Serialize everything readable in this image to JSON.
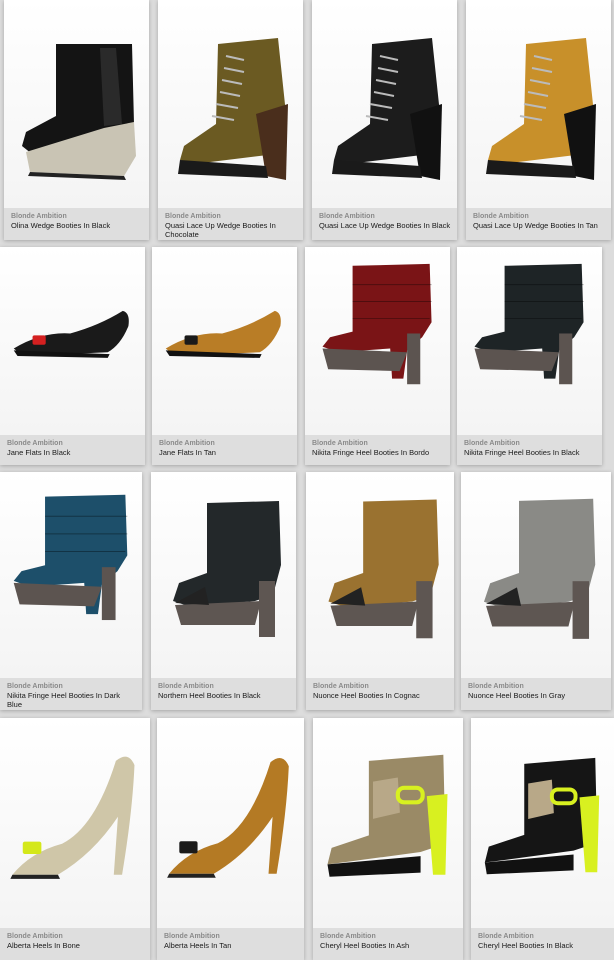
{
  "colors": {
    "page_bg": "#dcdcdc",
    "caption_bg": "#dedede",
    "brand_text": "#8a8a8a",
    "name_text": "#1a1a1a"
  },
  "products": [
    {
      "brand": "Blonde Ambition",
      "name": "Olina Wedge Booties In Black",
      "shoe": "wedge-bootie",
      "upper": "#141414",
      "accent": "#c9c4b4"
    },
    {
      "brand": "Blonde Ambition",
      "name": "Quasi Lace Up Wedge Booties In Chocolate",
      "shoe": "lace-wedge",
      "upper": "#6b5a22",
      "accent": "#4a2e1c"
    },
    {
      "brand": "Blonde Ambition",
      "name": "Quasi Lace Up Wedge Booties In Black",
      "shoe": "lace-wedge",
      "upper": "#1c1c1c",
      "accent": "#111111"
    },
    {
      "brand": "Blonde Ambition",
      "name": "Quasi Lace Up Wedge Booties In Tan",
      "shoe": "lace-wedge",
      "upper": "#c8902a",
      "accent": "#111111"
    },
    {
      "brand": "Blonde Ambition",
      "name": "Jane Flats In Black",
      "shoe": "flat",
      "upper": "#1a1a1a",
      "accent": "#d42020"
    },
    {
      "brand": "Blonde Ambition",
      "name": "Jane Flats In Tan",
      "shoe": "flat",
      "upper": "#b97d26",
      "accent": "#1a1a1a"
    },
    {
      "brand": "Blonde Ambition",
      "name": "Nikita Fringe Heel Booties In Bordo",
      "shoe": "fringe-heel",
      "upper": "#7a1416",
      "accent": "#5c5450"
    },
    {
      "brand": "Blonde Ambition",
      "name": "Nikita Fringe Heel Booties In Black",
      "shoe": "fringe-heel",
      "upper": "#1e2426",
      "accent": "#5c5450"
    },
    {
      "brand": "Blonde Ambition",
      "name": "Nikita Fringe Heel Booties In Dark Blue",
      "shoe": "fringe-heel",
      "upper": "#1d4f6a",
      "accent": "#5c5450"
    },
    {
      "brand": "Blonde Ambition",
      "name": "Northern Heel Booties In Black",
      "shoe": "heel-bootie",
      "upper": "#23282a",
      "accent": "#5c5450"
    },
    {
      "brand": "Blonde Ambition",
      "name": "Nuonce Heel Booties In Cognac",
      "shoe": "heel-bootie",
      "upper": "#9a7230",
      "accent": "#5c5450"
    },
    {
      "brand": "Blonde Ambition",
      "name": "Nuonce Heel Booties In Gray",
      "shoe": "heel-bootie",
      "upper": "#8a8a86",
      "accent": "#5c5450"
    },
    {
      "brand": "Blonde Ambition",
      "name": "Alberta Heels In Bone",
      "shoe": "pump",
      "upper": "#cfc6a8",
      "accent": "#d4e81a"
    },
    {
      "brand": "Blonde Ambition",
      "name": "Alberta Heels In Tan",
      "shoe": "pump",
      "upper": "#b47a24",
      "accent": "#1a1a1a"
    },
    {
      "brand": "Blonde Ambition",
      "name": "Cheryl Heel Booties In Ash",
      "shoe": "cheryl",
      "upper": "#9a8a66",
      "accent": "#d8f020"
    },
    {
      "brand": "Blonde Ambition",
      "name": "Cheryl Heel Booties In Black",
      "shoe": "cheryl",
      "upper": "#151515",
      "accent": "#d8f020"
    }
  ]
}
